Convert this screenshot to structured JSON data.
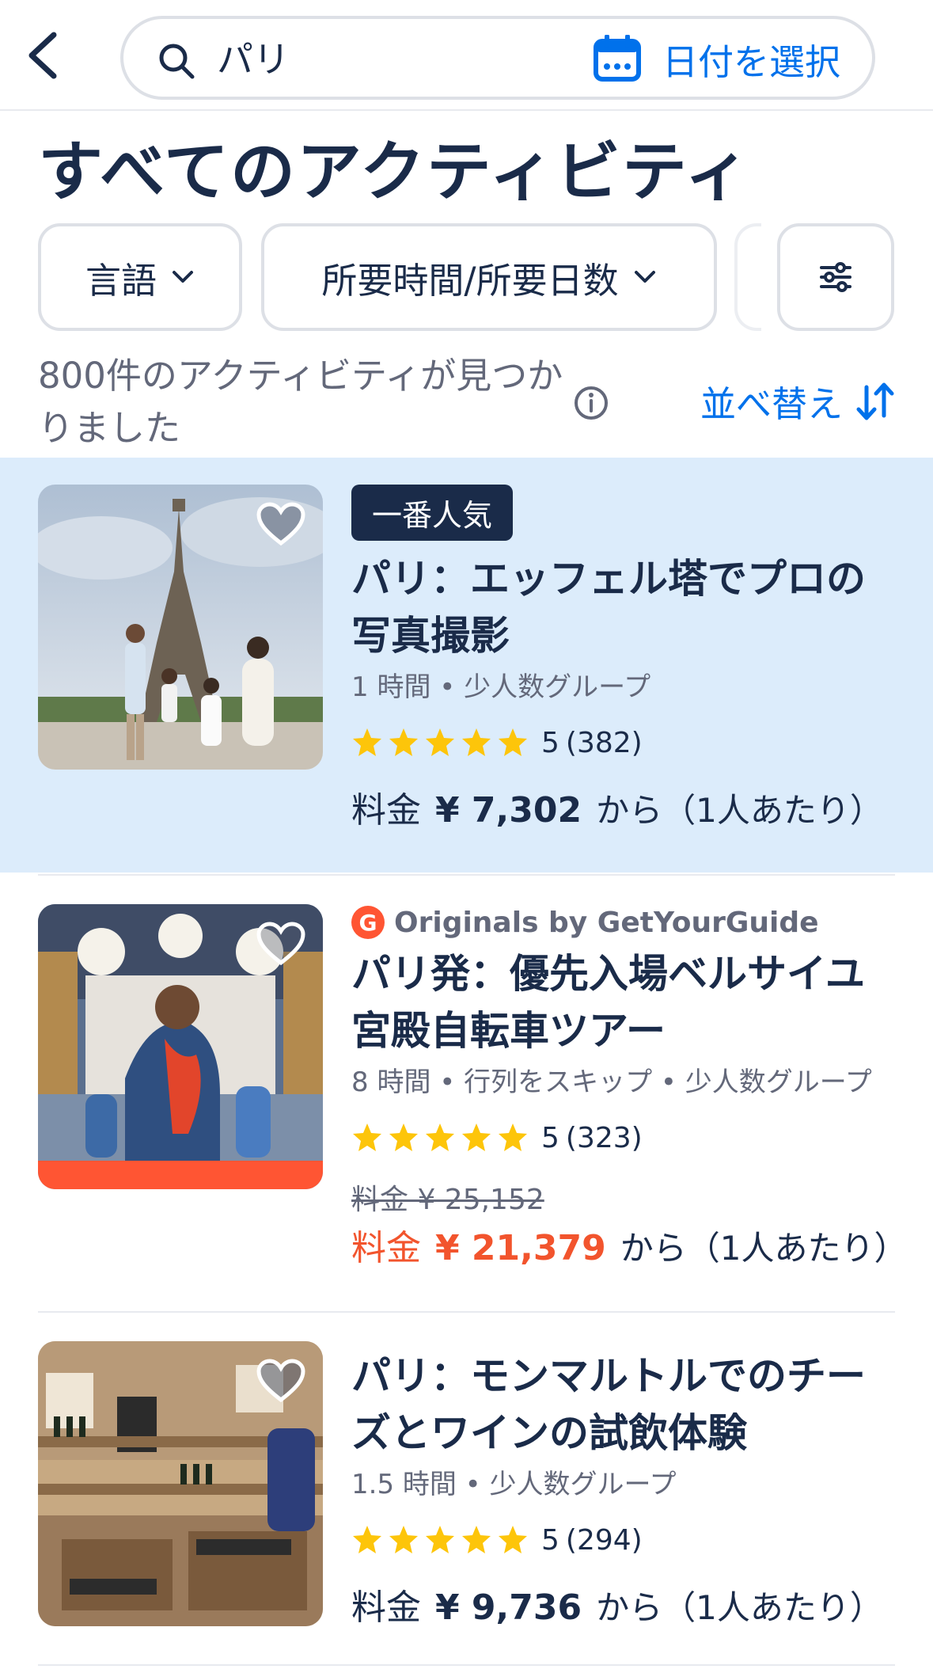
{
  "header": {
    "search_query": "パリ",
    "date_label": "日付を選択"
  },
  "page_title": "すべてのアクティビティ",
  "filters": [
    {
      "label": "言語"
    },
    {
      "label": "所要時間/所要日数"
    }
  ],
  "results": {
    "count_text": "800件のアクティビティが見つかりました",
    "sort_label": "並べ替え"
  },
  "cards": [
    {
      "badge": "一番人気",
      "title": "パリ：エッフェル塔でプロの写真撮影",
      "meta": "1 時間 • 少人数グループ",
      "rating": "5",
      "reviews": "(382)",
      "price_label": "料金",
      "price": "¥ 7,302",
      "price_suffix": "から（1人あたり）"
    },
    {
      "originals": "Originals by GetYourGuide",
      "title": "パリ発：優先入場ベルサイユ宮殿自転車ツアー",
      "meta": "8 時間 • 行列をスキップ • 少人数グループ",
      "rating": "5",
      "reviews": "(323)",
      "old_price": "料金 ¥ 25,152",
      "price_label": "料金",
      "price": "¥ 21,379",
      "price_suffix": "から（1人あたり）"
    },
    {
      "title": "パリ：モンマルトルでのチーズとワインの試飲体験",
      "meta": "1.5 時間 • 少人数グループ",
      "rating": "5",
      "reviews": "(294)",
      "price_label": "料金",
      "price": "¥ 9,736",
      "price_suffix": "から（1人あたり）"
    }
  ],
  "colors": {
    "brand_blue": "#0071eb",
    "navy": "#1a2b49",
    "highlight": "#dcecfb",
    "sale": "#f2542d",
    "star": "#fdc50a"
  }
}
